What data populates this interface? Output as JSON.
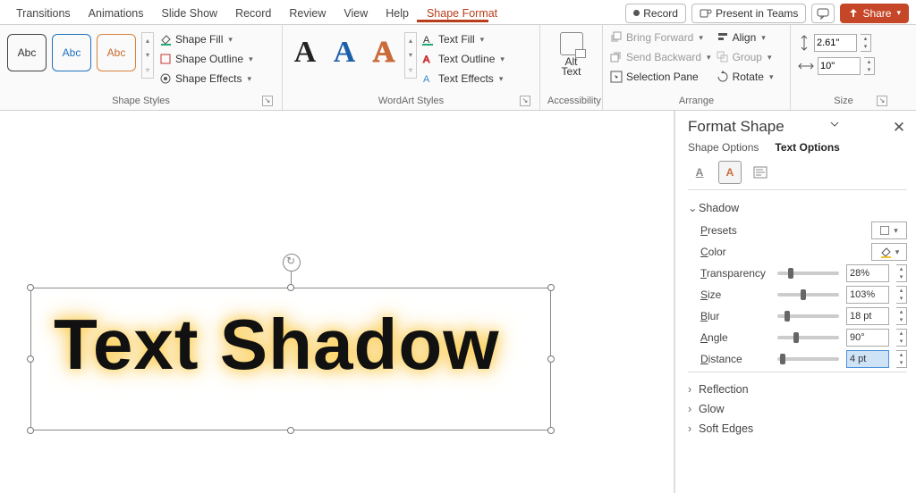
{
  "menu": {
    "tabs": [
      "Transitions",
      "Animations",
      "Slide Show",
      "Record",
      "Review",
      "View",
      "Help",
      "Shape Format"
    ],
    "active": "Shape Format",
    "record_btn": "Record",
    "teams_btn": "Present in Teams",
    "share_btn": "Share"
  },
  "ribbon": {
    "shape_styles": {
      "label": "Shape Styles",
      "abc": "Abc",
      "fill": "Shape Fill",
      "outline": "Shape Outline",
      "effects": "Shape Effects"
    },
    "wordart": {
      "label": "WordArt Styles",
      "text_fill": "Text Fill",
      "text_outline": "Text Outline",
      "text_effects": "Text Effects"
    },
    "accessibility": {
      "label": "Accessibility",
      "alt_text_top": "Alt",
      "alt_text_bottom": "Text"
    },
    "arrange": {
      "label": "Arrange",
      "bring_forward": "Bring Forward",
      "send_backward": "Send Backward",
      "selection_pane": "Selection Pane",
      "align": "Align",
      "group": "Group",
      "rotate": "Rotate"
    },
    "size": {
      "label": "Size",
      "height": "2.61\"",
      "width": "10\""
    }
  },
  "slide": {
    "text": "Text Shadow"
  },
  "pane": {
    "title": "Format Shape",
    "shape_options": "Shape Options",
    "text_options": "Text Options",
    "sections": {
      "shadow": "Shadow",
      "reflection": "Reflection",
      "glow": "Glow",
      "soft_edges": "Soft Edges"
    },
    "props": {
      "presets": "Presets",
      "color": "Color",
      "transparency": "Transparency",
      "size": "Size",
      "blur": "Blur",
      "angle": "Angle",
      "distance": "Distance"
    },
    "values": {
      "transparency": "28%",
      "size": "103%",
      "blur": "18 pt",
      "angle": "90°",
      "distance": "4 pt"
    },
    "slider_pos": {
      "transparency": 18,
      "size": 38,
      "blur": 12,
      "angle": 26,
      "distance": 4
    }
  }
}
